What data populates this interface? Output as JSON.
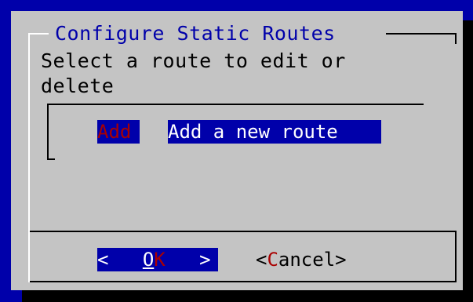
{
  "dialog": {
    "title": "Configure Static Routes",
    "prompt_line1": "Select a route to edit or",
    "prompt_line2": "delete"
  },
  "list": {
    "items": [
      {
        "tag": "Add",
        "description": "Add a new route"
      }
    ]
  },
  "buttons": {
    "ok": {
      "left": "<",
      "underline": "O",
      "hot": "K",
      "right": ">"
    },
    "cancel": {
      "open": "<",
      "hot": "C",
      "rest": "ancel>"
    }
  },
  "colors": {
    "screen_bg": "#0000aa",
    "dialog_bg": "#c4c4c4",
    "selected_bg": "#0000aa",
    "hotkey": "#aa0000",
    "title": "#0000aa"
  }
}
